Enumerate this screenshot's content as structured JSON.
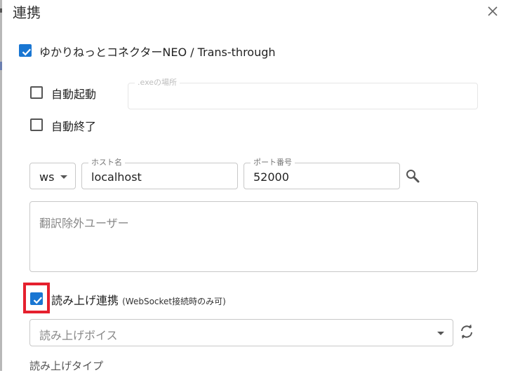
{
  "dialog": {
    "title": "連携"
  },
  "yukari": {
    "label": "ゆかりねっとコネクターNEO / Trans-through",
    "checked": true
  },
  "auto_start": {
    "label": "自動起動",
    "checked": false
  },
  "auto_end": {
    "label": "自動終了",
    "checked": false
  },
  "exe_path": {
    "legend": ".exeの場所",
    "value": ""
  },
  "connection": {
    "protocol": "ws",
    "host_legend": "ホスト名",
    "host_value": "localhost",
    "port_legend": "ポート番号",
    "port_value": "52000"
  },
  "exclude_users": {
    "placeholder": "翻訳除外ユーザー"
  },
  "read_aloud": {
    "label": "読み上げ連携",
    "note": "(WebSocket接続時のみ可)",
    "checked": true
  },
  "voice": {
    "placeholder": "読み上げボイス"
  },
  "read_type": {
    "label": "読み上げタイプ"
  },
  "icons": {
    "close": "close-icon",
    "search": "search-icon",
    "refresh": "refresh-icon",
    "check": "check-icon",
    "dropdown": "chevron-down-icon"
  },
  "colors": {
    "accent": "#1976d2",
    "highlight": "#e5202e",
    "border": "#c8c8c8"
  }
}
